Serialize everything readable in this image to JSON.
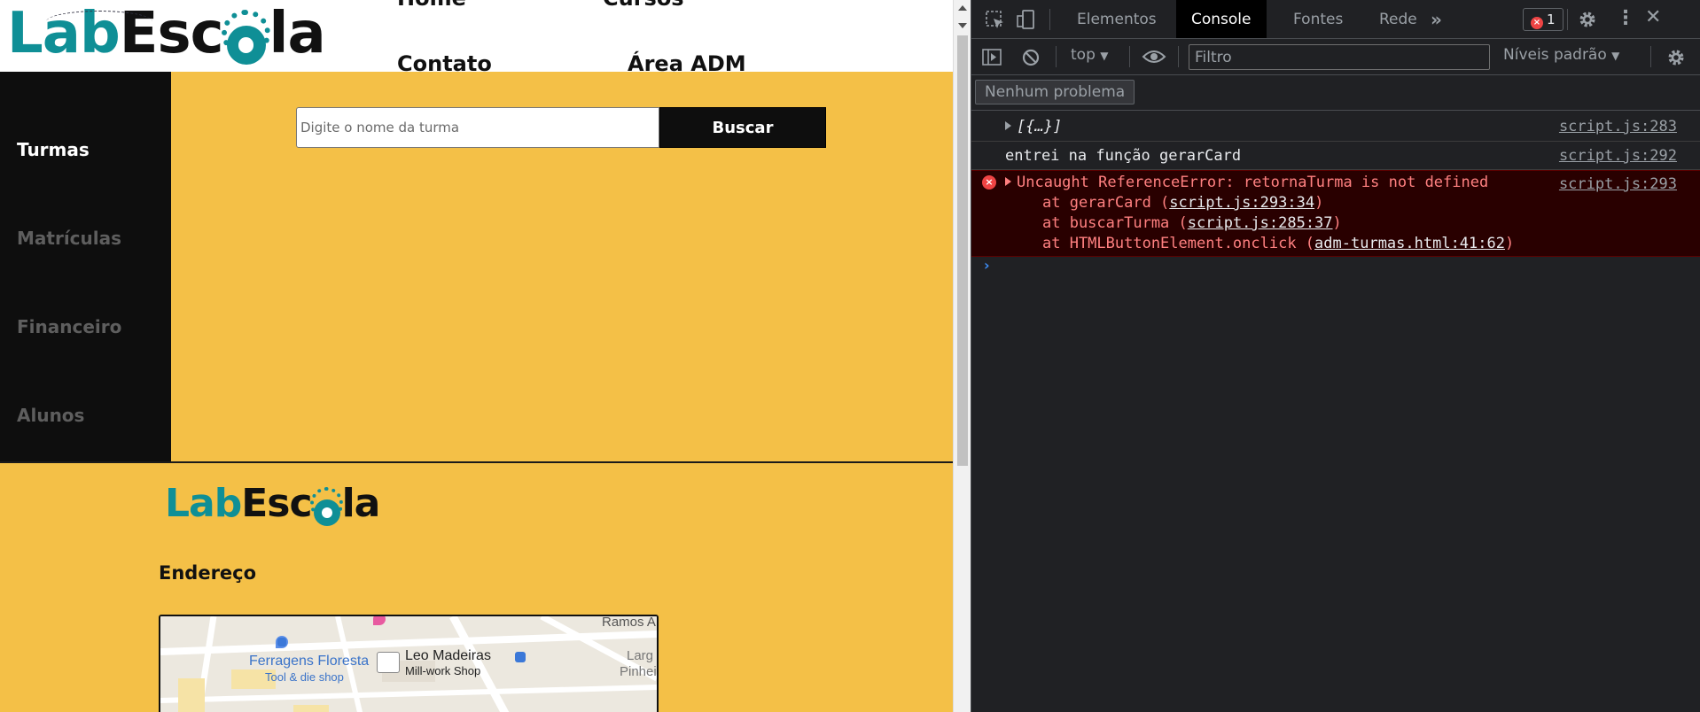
{
  "site": {
    "logo": {
      "prefix": "Lab",
      "middle": "Esc",
      "suffix": "la"
    },
    "nav": [
      "Home",
      "Cursos",
      "Contato",
      "Área ADM"
    ],
    "sidebar": {
      "items": [
        "Turmas",
        "Matrículas",
        "Financeiro",
        "Alunos"
      ],
      "active": "Turmas"
    },
    "search": {
      "placeholder": "Digite o nome da turma",
      "value": "",
      "button_label": "Buscar"
    },
    "footer": {
      "address_title": "Endereço",
      "map_labels": {
        "place1": "Ferragens Floresta",
        "place1_sub": "Tool & die shop",
        "place2": "Leo Madeiras",
        "place2_sub": "Mill-work Shop",
        "street1": "Ramos A",
        "street2": "Larg",
        "street3": "Pinhei"
      }
    },
    "colors": {
      "accent": "#f4c047",
      "dark": "#0e0e0e",
      "brand_teal": "#0f8f96"
    }
  },
  "devtools": {
    "tabs": [
      "Elementos",
      "Console",
      "Fontes",
      "Rede"
    ],
    "active_tab": "Console",
    "error_count": "1",
    "context": "top",
    "filter_placeholder": "Filtro",
    "levels": "Níveis padrão",
    "issues": "Nenhum problema",
    "logs": [
      {
        "text": "[{…}]",
        "source": "script.js:283"
      },
      {
        "text": "entrei na função gerarCard",
        "source": "script.js:292"
      }
    ],
    "error": {
      "message": "Uncaught ReferenceError: retornaTurma is not defined",
      "source": "script.js:293",
      "stack": [
        {
          "prefix": "at gerarCard (",
          "link": "script.js:293:34",
          "suffix": ")"
        },
        {
          "prefix": "at buscarTurma (",
          "link": "script.js:285:37",
          "suffix": ")"
        },
        {
          "prefix": "at HTMLButtonElement.onclick (",
          "link": "adm-turmas.html:41:62",
          "suffix": ")"
        }
      ]
    },
    "prompt": "›"
  }
}
